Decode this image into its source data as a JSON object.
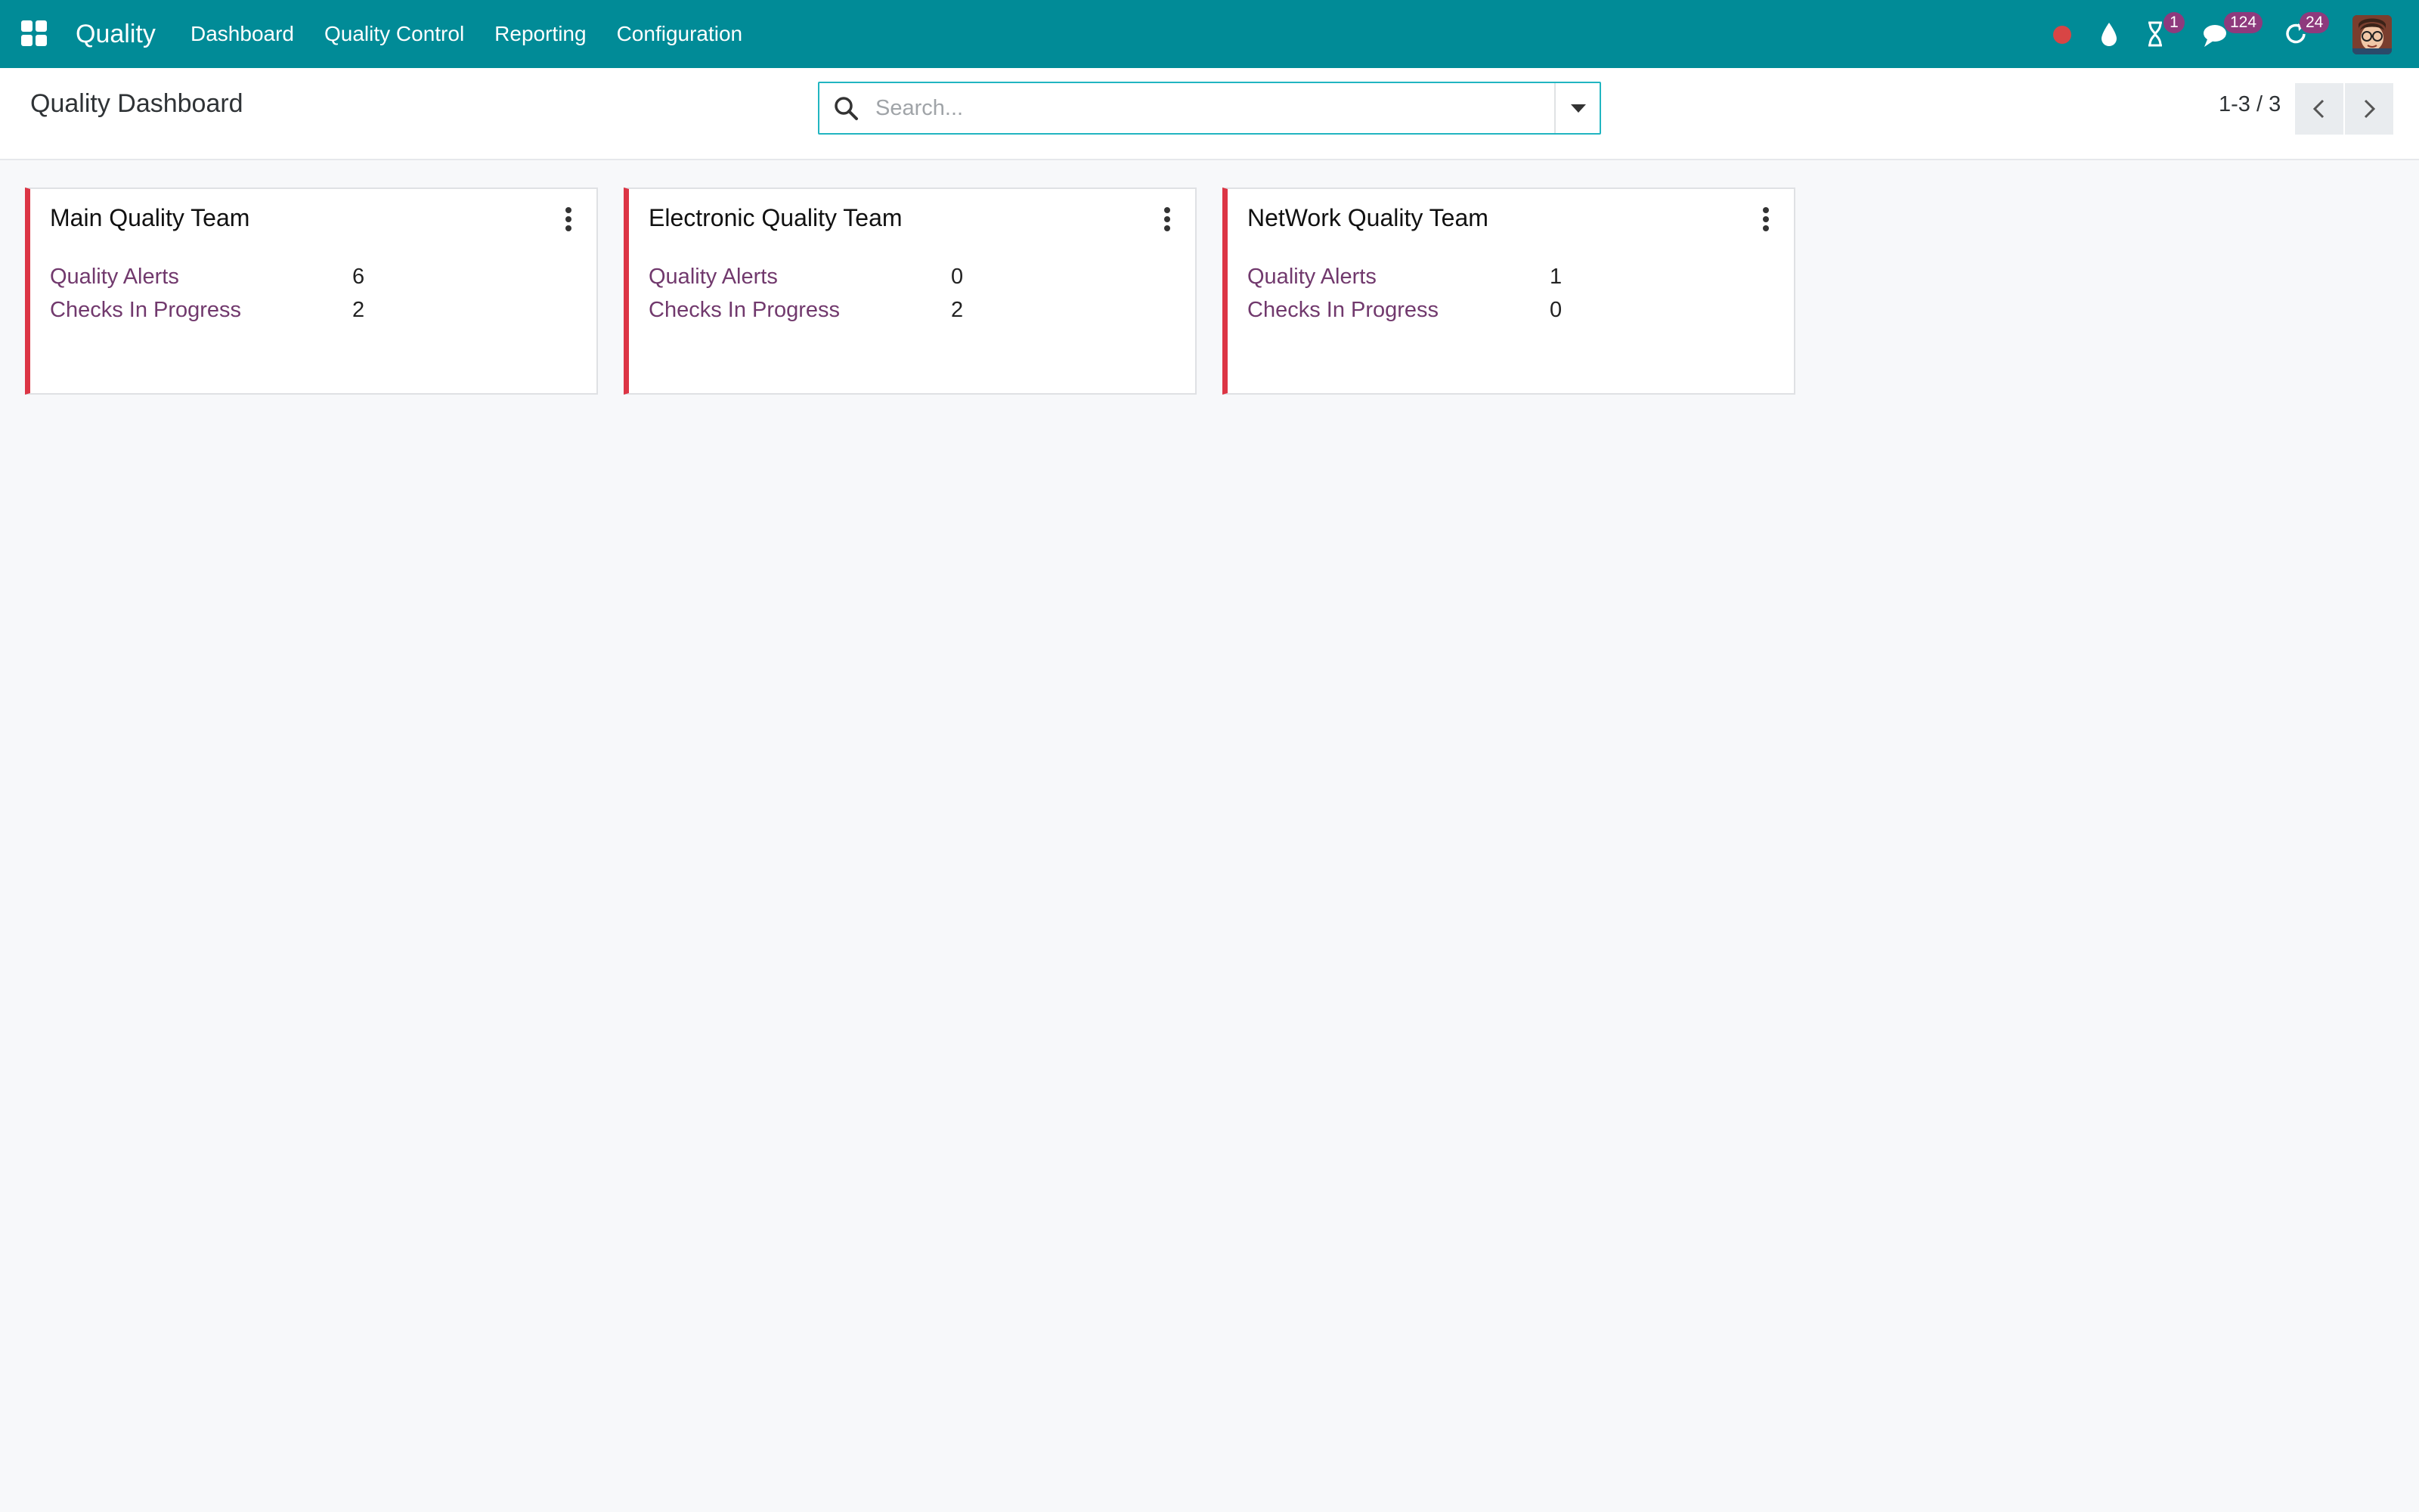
{
  "navbar": {
    "brand": "Quality",
    "menu": [
      "Dashboard",
      "Quality Control",
      "Reporting",
      "Configuration"
    ],
    "systray": {
      "activity_badge": "1",
      "messages_badge": "124",
      "updates_badge": "24"
    },
    "bg_color": "#018b97"
  },
  "control_panel": {
    "title": "Quality Dashboard",
    "search_placeholder": "Search...",
    "pager": "1-3 / 3"
  },
  "teams": [
    {
      "name": "Main Quality Team",
      "alerts_label": "Quality Alerts",
      "alerts": "6",
      "checks_label": "Checks In Progress",
      "checks": "2"
    },
    {
      "name": "Electronic Quality Team",
      "alerts_label": "Quality Alerts",
      "alerts": "0",
      "checks_label": "Checks In Progress",
      "checks": "2"
    },
    {
      "name": "NetWork Quality Team",
      "alerts_label": "Quality Alerts",
      "alerts": "1",
      "checks_label": "Checks In Progress",
      "checks": "0"
    }
  ],
  "colors": {
    "card_accent": "#dc3545",
    "link": "#71396d",
    "badge": "#8e3a7d"
  }
}
